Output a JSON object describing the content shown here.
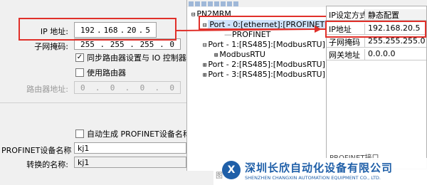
{
  "left_panel": {
    "ip_label": "IP 地址:",
    "ip": [
      "192",
      "168",
      "20",
      "5"
    ],
    "subnet_label": "子网掩码:",
    "subnet": [
      "255",
      "255",
      "255",
      "0"
    ],
    "sync_router_label": "同步路由器设置与 IO 控制器",
    "sync_router_checked": "✓",
    "use_router_label": "使用路由器",
    "router_label": "路由器地址:",
    "router": [
      "0",
      "0",
      "0",
      "0"
    ],
    "auto_name_label": "自动生成 PROFINET设备名称",
    "device_name_label": "PROFINET设备名称",
    "device_name": "kj1",
    "converted_name_label": "转换的名称:",
    "converted_name": "kj1"
  },
  "tree": {
    "root": "PN2MRM",
    "port0": "Port - 0:[ethernet]:[PROFINET]",
    "profinet": "PROFINET",
    "port1": "Port - 1:[RS485]:[ModbusRTU]",
    "modbusrtu": "ModbusRTU",
    "port2": "Port - 2:[RS485]:[ModbusRTU]",
    "port3": "Port - 3:[RS485]:[ModbusRTU]",
    "expand_minus": "⊟",
    "expand_plus": "⊞"
  },
  "grid": {
    "rows": [
      {
        "key": "IP设定方式",
        "value": "静态配置"
      },
      {
        "key": "IP地址",
        "value": "192.168.20.5"
      },
      {
        "key": "子网掩码",
        "value": "255.255.255.0"
      },
      {
        "key": "网关地址",
        "value": "0.0.0.0"
      }
    ],
    "bottom_label": "PROFINET接口"
  },
  "footer": {
    "fig_label": "图",
    "company_cn": "深圳长欣自动化设备有限公司",
    "company_en": "SHENZHEN CHANGXIN AUTOMATION EQUIPMENT CO., LTD.",
    "logo_text": "X"
  },
  "colors": {
    "highlight_red": "#e0302a",
    "selection_blue": "#cfe3fb",
    "brand_blue": "#1f5fa8"
  }
}
